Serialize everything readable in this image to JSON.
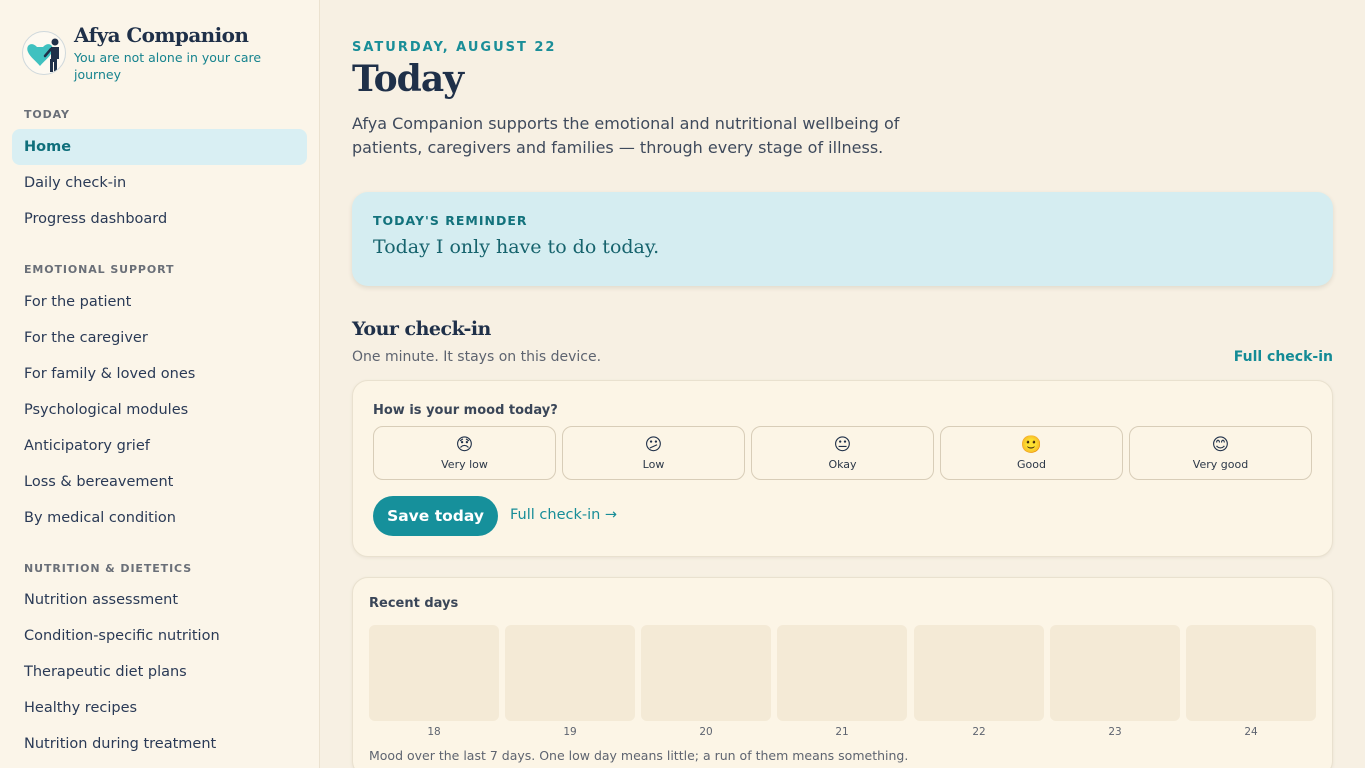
{
  "brand": {
    "title": "Afya Companion",
    "tagline": "You are not alone in your care journey"
  },
  "sidebar": {
    "sections": [
      {
        "title": "TODAY",
        "items": [
          {
            "label": "Home",
            "active": true
          },
          {
            "label": "Daily check-in"
          },
          {
            "label": "Progress dashboard"
          }
        ]
      },
      {
        "title": "EMOTIONAL SUPPORT",
        "items": [
          {
            "label": "For the patient"
          },
          {
            "label": "For the caregiver"
          },
          {
            "label": "For family & loved ones"
          },
          {
            "label": "Psychological modules"
          },
          {
            "label": "Anticipatory grief"
          },
          {
            "label": "Loss & bereavement"
          },
          {
            "label": "By medical condition"
          }
        ]
      },
      {
        "title": "NUTRITION & DIETETICS",
        "items": [
          {
            "label": "Nutrition assessment"
          },
          {
            "label": "Condition-specific nutrition"
          },
          {
            "label": "Therapeutic diet plans"
          },
          {
            "label": "Healthy recipes"
          },
          {
            "label": "Nutrition during treatment"
          }
        ]
      }
    ]
  },
  "header": {
    "date": "SATURDAY, AUGUST 22",
    "title": "Today",
    "intro": "Afya Companion supports the emotional and nutritional wellbeing of patients, caregivers and families — through every stage of illness."
  },
  "reminder": {
    "label": "TODAY'S REMINDER",
    "text": "Today I only have to do today."
  },
  "checkin": {
    "title": "Your check-in",
    "subtitle": "One minute. It stays on this device.",
    "full_link": "Full check-in",
    "question": "How is your mood today?",
    "options": [
      {
        "emoji": "😞",
        "label": "Very low"
      },
      {
        "emoji": "😕",
        "label": "Low"
      },
      {
        "emoji": "😐",
        "label": "Okay"
      },
      {
        "emoji": "🙂",
        "label": "Good"
      },
      {
        "emoji": "😊",
        "label": "Very good"
      }
    ],
    "save_label": "Save today",
    "full_checkin_arrow": "Full check-in →"
  },
  "recent": {
    "title": "Recent days",
    "days": [
      "18",
      "19",
      "20",
      "21",
      "22",
      "23",
      "24"
    ],
    "note": "Mood over the last 7 days. One low day means little; a run of them means something."
  },
  "colors": {
    "accent": "#16909b",
    "background": "#f7f0e3",
    "reminder_bg": "#d5edf1",
    "navy": "#1f3049"
  }
}
